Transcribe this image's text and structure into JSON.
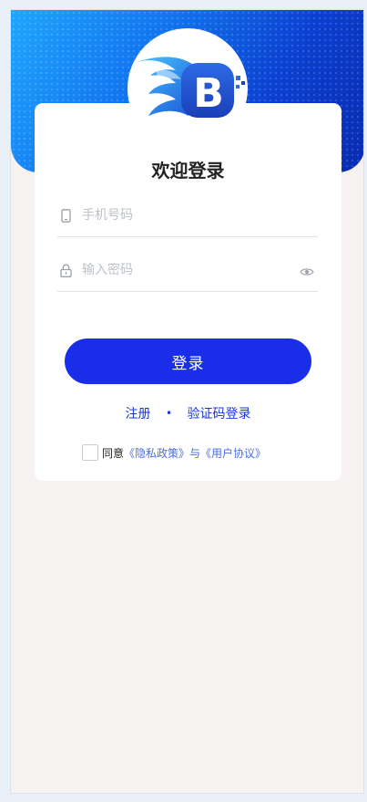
{
  "header": {
    "logo_letter": "B"
  },
  "login": {
    "title": "欢迎登录",
    "phone_placeholder": "手机号码",
    "password_placeholder": "输入密码",
    "submit_label": "登录",
    "register_label": "注册",
    "separator": "•",
    "sms_login_label": "验证码登录",
    "agree_prefix": "同意",
    "privacy_link": "《隐私政策》",
    "agree_joiner": "与",
    "terms_link": "《用户协议》"
  },
  "icons": {
    "phone": "phone-icon",
    "lock": "lock-icon",
    "eye": "eye-icon"
  },
  "colors": {
    "primary": "#1a2eea",
    "link": "#1a36d8",
    "agreement_link": "#4a6fe0",
    "banner_light": "#1fa6ff",
    "banner_dark": "#082bb0"
  }
}
